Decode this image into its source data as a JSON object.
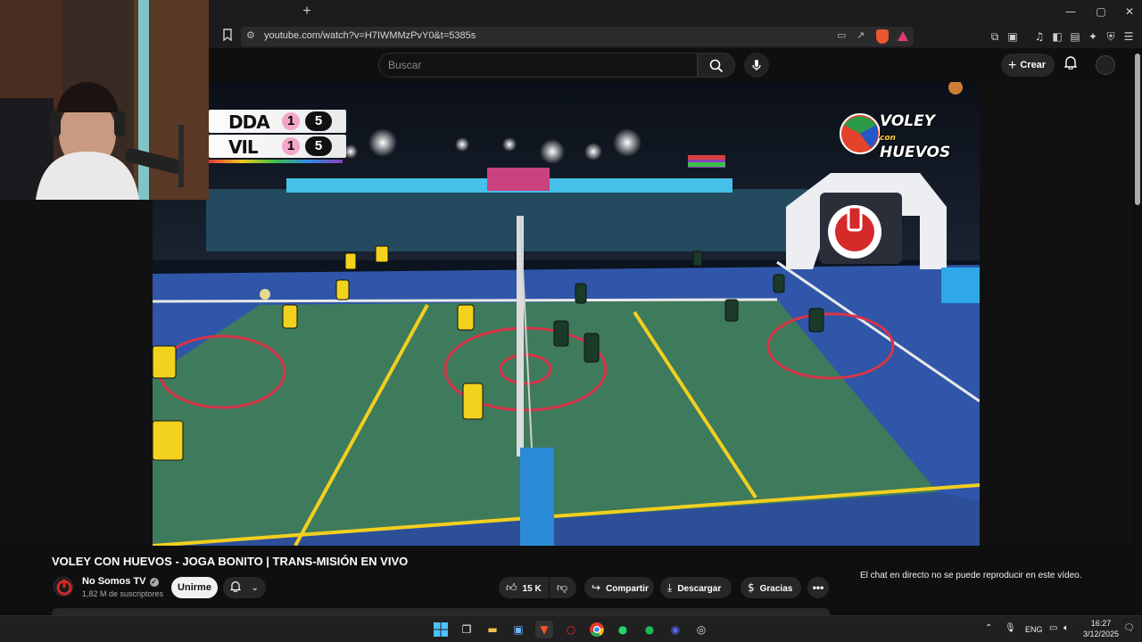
{
  "browser": {
    "url": "youtube.com/watch?v=H7IWMMzPvY0&t=5385s",
    "new_tab_label": "+",
    "window_controls": {
      "minimize": "—",
      "maximize": "▢",
      "close": "✕"
    }
  },
  "youtube_header": {
    "search_placeholder": "Buscar",
    "create_label": "Crear"
  },
  "video": {
    "scoreboard": {
      "teams": [
        {
          "name": "DDA",
          "sets": "1",
          "points": "5"
        },
        {
          "name": "VIL",
          "sets": "1",
          "points": "5"
        }
      ]
    },
    "brand_logo": {
      "line1": "VOLEY",
      "con": "con",
      "line2": "HUEVOS"
    }
  },
  "video_info": {
    "title": "VOLEY CON HUEVOS - JOGA BONITO | TRANS-MISIÓN EN VIVO",
    "channel_name": "No Somos TV",
    "subscribers": "1,82 M de suscriptores",
    "join_label": "Unirme",
    "like_count": "15 K",
    "share_label": "Compartir",
    "download_label": "Descargar",
    "thanks_label": "Gracias",
    "more_label": "•••"
  },
  "chat": {
    "notice": "El chat en directo no se puede reproducir en este vídeo."
  },
  "taskbar": {
    "language": "ENG",
    "time": "16:27",
    "date": "3/12/2025"
  },
  "colors": {
    "page_bg": "#0f0f0f",
    "court_green": "#3e7a5c",
    "court_blue": "#2f56a8",
    "court_line_yellow": "#f2cf1f",
    "court_line_red": "#d8344a",
    "score_pink": "#f4a6c8",
    "team_yellow": "#f2d21d"
  }
}
